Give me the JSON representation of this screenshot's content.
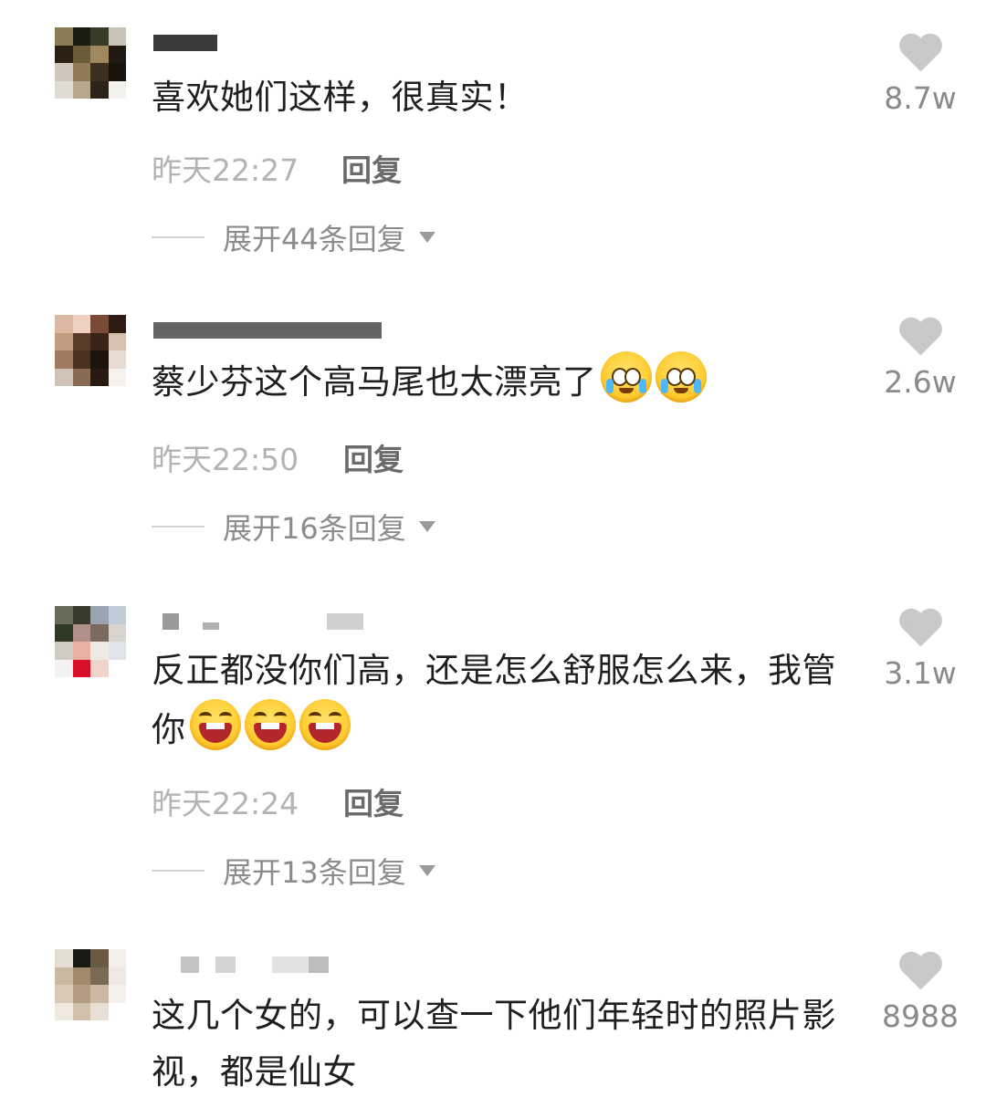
{
  "comments": [
    {
      "text": "喜欢她们这样，很真实！",
      "time": "昨天22:27",
      "reply_label": "回复",
      "expand_label": "展开44条回复",
      "likes": "8.7w",
      "emojis": [],
      "avatar_colors": [
        "#8a7c55",
        "#1c1c14",
        "#3a3a28",
        "#c8c2b8",
        "#2a2014",
        "#6b5c3a",
        "#a08860",
        "#221a12",
        "#cfc7bb",
        "#907a55",
        "#3d2f1e",
        "#1a140d",
        "#e0dcd5",
        "#b8a78a",
        "#2c2418",
        "#f3f1ed"
      ]
    },
    {
      "text": "蔡少芬这个高马尾也太漂亮了",
      "time": "昨天22:50",
      "reply_label": "回复",
      "expand_label": "展开16条回复",
      "likes": "2.6w",
      "emojis": [
        "cry-emoji",
        "cry-emoji"
      ],
      "avatar_colors": [
        "#dcb8a3",
        "#f0d0c0",
        "#7a4a36",
        "#2e1c14",
        "#c29a80",
        "#5c3a2a",
        "#3a2418",
        "#d8c0b0",
        "#a07a60",
        "#4a3020",
        "#1e140e",
        "#e8dcd2",
        "#cfc2b6",
        "#8a6a52",
        "#281a12",
        "#f6f2ee"
      ]
    },
    {
      "text": "反正都没你们高，还是怎么舒服怎么来，我管你",
      "time": "昨天22:24",
      "reply_label": "回复",
      "expand_label": "展开13条回复",
      "likes": "3.1w",
      "emojis": [
        "laugh-emoji",
        "laugh-emoji",
        "laugh-emoji"
      ],
      "avatar_colors": [
        "#6a6a5a",
        "#3a3a2e",
        "#9aa4b0",
        "#c0ccd8",
        "#2e3a24",
        "#b09088",
        "#7a6a60",
        "#d8d4d0",
        "#cfcac4",
        "#e8b0a0",
        "#f0e8e4",
        "#e0e4e8",
        "#f4f2f0",
        "#d8102a",
        "#f0d4cc",
        "#ffffff"
      ]
    },
    {
      "text": "这几个女的，可以查一下他们年轻时的照片影视，都是仙女",
      "time": "",
      "reply_label": "",
      "expand_label": "",
      "likes": "8988",
      "emojis": [],
      "avatar_colors": [
        "#e4ddd4",
        "#1a1a14",
        "#6a5a44",
        "#f2eee8",
        "#cbb8a0",
        "#a08a6a",
        "#7a6a54",
        "#efe9e2",
        "#d9cab8",
        "#b39c80",
        "#cbb9a4",
        "#f4f1ec",
        "#eee8e0",
        "#d0c0ac",
        "#e8e0d6",
        "#ffffff"
      ]
    }
  ]
}
